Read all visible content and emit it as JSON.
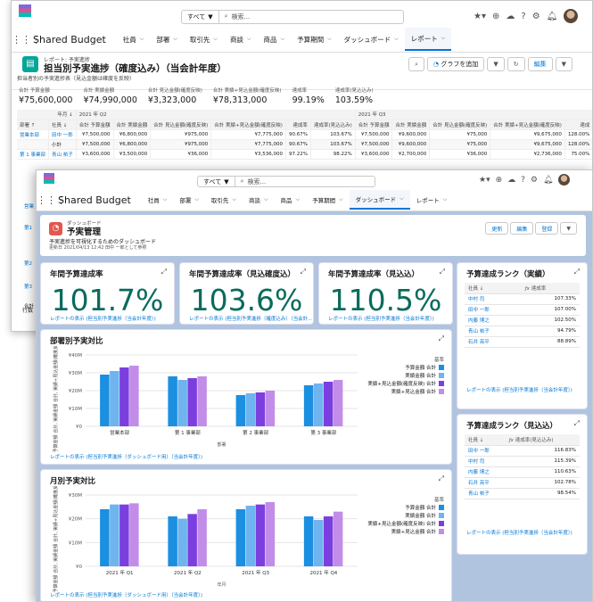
{
  "app": {
    "name": "Shared Budget",
    "search_scope": "すべて",
    "search_placeholder": "検索...",
    "nav": [
      {
        "label": "社員"
      },
      {
        "label": "部署"
      },
      {
        "label": "取引先"
      },
      {
        "label": "商談"
      },
      {
        "label": "商品"
      },
      {
        "label": "予算期間"
      },
      {
        "label": "ダッシュボード"
      },
      {
        "label": "レポート"
      }
    ]
  },
  "report": {
    "type_label": "レポート: 予実進捗",
    "title": "担当別予実進捗（確度込み）（当会計年度）",
    "subtitle": "担当者別の予実進捗表（見込金額は確度を反映）",
    "buttons": {
      "add_chart": "グラフを追加",
      "edit": "編集"
    },
    "totals": [
      {
        "label": "合計 予算金額",
        "value": "¥75,600,000"
      },
      {
        "label": "合計 実績金額",
        "value": "¥74,990,000"
      },
      {
        "label": "合計 見込金額(確度反映)",
        "value": "¥3,323,000"
      },
      {
        "label": "合計 実績+見込金額(確度反映)",
        "value": "¥78,313,000"
      },
      {
        "label": "達成率",
        "value": "99.19%"
      },
      {
        "label": "達成率(見込込み)",
        "value": "103.59%"
      }
    ],
    "group_row": {
      "month": "年月 ↓",
      "q2": "2021 年 Q2",
      "q3": "2021 年 Q3"
    },
    "col_headers": [
      "部署 ↑",
      "社員 ↓",
      "合計 予算金額",
      "合計 実績金額",
      "合計 見込金額(確度反映)",
      "合計 実績+見込金額(確度反映)",
      "達成率",
      "達成率(見込込み)",
      "合計 予算金額",
      "合計 実績金額",
      "合計 見込金額(確度反映)",
      "合計 実績+見込金額(確度反映)",
      "達成"
    ],
    "rows": [
      [
        "営業本部",
        "田中 一郎",
        "¥7,500,000",
        "¥6,800,000",
        "¥975,000",
        "¥7,775,000",
        "90.67%",
        "103.67%",
        "¥7,500,000",
        "¥9,600,000",
        "¥75,000",
        "¥9,675,000",
        "128.00%"
      ],
      [
        "",
        "小計",
        "¥7,500,000",
        "¥6,800,000",
        "¥975,000",
        "¥7,775,000",
        "90.67%",
        "103.67%",
        "¥7,500,000",
        "¥9,600,000",
        "¥75,000",
        "¥9,675,000",
        "128.00%"
      ],
      [
        "第 1 事業部",
        "青山 祐子",
        "¥3,600,000",
        "¥3,500,000",
        "¥36,000",
        "¥3,536,000",
        "97.22%",
        "98.22%",
        "¥3,600,000",
        "¥2,700,000",
        "¥36,000",
        "¥2,736,000",
        "75.00%"
      ]
    ],
    "side_labels": [
      "営業",
      "第1",
      "第2",
      "第3",
      "合計"
    ],
    "footer_label": "行数"
  },
  "dash": {
    "type_label": "ダッシュボード",
    "title": "予実管理",
    "subtitle": "予実進捗を可視化するためのダッシュボード",
    "updated": "更新日 2021/04/13 12:42 田中 一郎として参照",
    "buttons": {
      "refresh": "更新",
      "edit": "編集",
      "subscribe": "登録"
    },
    "kpis": [
      {
        "title": "年間予算達成率",
        "value": "101.7%",
        "link": "レポートの表示 (担当別予実進捗（当会計年度）)"
      },
      {
        "title": "年間予算達成率（見込確度込）",
        "value": "103.6%",
        "link": "レポートの表示 (担当別予実進捗（確度込み）（当会計..."
      },
      {
        "title": "年間予算達成率（見込込）",
        "value": "110.5%",
        "link": "レポートの表示 (担当別予実進捗（当会計年度）)"
      }
    ],
    "rank1": {
      "title": "予算達成ランク（実績）",
      "col1": "社員 ↓",
      "col2": "達成率",
      "rows": [
        [
          "中村 司",
          "107.33%"
        ],
        [
          "田中 一郎",
          "107.00%"
        ],
        [
          "内藤 博之",
          "102.50%"
        ],
        [
          "青山 祐子",
          "94.79%"
        ],
        [
          "石井 亮平",
          "88.89%"
        ]
      ],
      "link": "レポートの表示 (担当別予実進捗（当会計年度）)"
    },
    "rank2": {
      "title": "予算達成ランク（見込込）",
      "col1": "社員 ↓",
      "col2": "達成率(見込込み)",
      "rows": [
        [
          "田中 一郎",
          "116.83%"
        ],
        [
          "中村 司",
          "115.39%"
        ],
        [
          "内藤 博之",
          "110.63%"
        ],
        [
          "石井 亮平",
          "102.78%"
        ],
        [
          "青山 祐子",
          "98.54%"
        ]
      ],
      "link": "レポートの表示 (担当別予実進捗（当会計年度）)"
    },
    "chart1": {
      "title": "部署別予実対比",
      "link": "レポートの表示 (担当別予実進捗（ダッシュボード用）（当会計年度）)"
    },
    "chart2": {
      "title": "月別予実対比",
      "link": "レポートの表示 (担当別予実進捗（ダッシュボード用）（当会計年度）)"
    }
  },
  "colors": {
    "brand": "#0176d3",
    "s1": "#1b8fe0",
    "s2": "#6fb3ef",
    "s3": "#7b3fe0",
    "s4": "#c28de8",
    "kpi": "#096b5c"
  },
  "chart_data": [
    {
      "type": "bar",
      "title": "部署別予実対比",
      "xlabel": "部署",
      "ylabel": "予算金額 合計, 実績金額 合計, 実績+見込金額(確度反映) 合...",
      "legend_title": "基準",
      "legend_position": "right",
      "categories": [
        "営業本部",
        "第 1 事業部",
        "第 2 事業部",
        "第 3 事業部"
      ],
      "yticks": [
        "¥40M",
        "¥30M",
        "¥20M",
        "¥10M",
        "¥0"
      ],
      "ylim": [
        0,
        40
      ],
      "grid": true,
      "series": [
        {
          "name": "予算金額 合計",
          "values": [
            29,
            28,
            17.5,
            23
          ]
        },
        {
          "name": "実績金額 合計",
          "values": [
            31,
            26,
            18.5,
            24
          ]
        },
        {
          "name": "実績+見込金額(確度反映) 合計",
          "values": [
            33,
            27,
            19,
            25
          ]
        },
        {
          "name": "実績+見込金額 合計",
          "values": [
            34,
            28,
            20,
            26
          ]
        }
      ]
    },
    {
      "type": "bar",
      "title": "月別予実対比",
      "xlabel": "年月",
      "ylabel": "予算金額 合計, 実績金額 合計, 実績+見込金額(確度反映) 合...",
      "legend_title": "基準",
      "legend_position": "right",
      "categories": [
        "2021 年 Q1",
        "2021 年 Q2",
        "2021 年 Q3",
        "2021 年 Q4"
      ],
      "yticks": [
        "¥30M",
        "¥20M",
        "¥10M",
        "¥0"
      ],
      "ylim": [
        0,
        30
      ],
      "grid": true,
      "series": [
        {
          "name": "予算金額 合計",
          "values": [
            24,
            21,
            24,
            21
          ]
        },
        {
          "name": "実績金額 合計",
          "values": [
            26,
            20,
            25.5,
            19.5
          ]
        },
        {
          "name": "実績+見込金額(確度反映) 合計",
          "values": [
            26,
            22,
            26,
            21
          ]
        },
        {
          "name": "実績+見込金額 合計",
          "values": [
            26.5,
            24,
            27,
            23
          ]
        }
      ]
    }
  ]
}
